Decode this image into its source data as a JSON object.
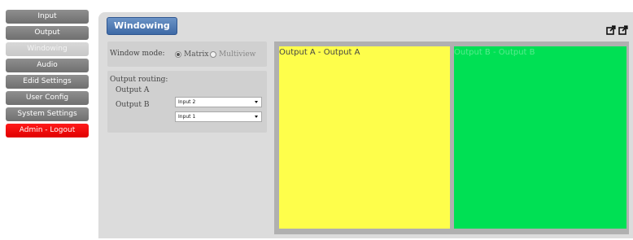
{
  "sidebar": {
    "items": [
      {
        "label": "Input"
      },
      {
        "label": "Output"
      },
      {
        "label": "Windowing"
      },
      {
        "label": "Audio"
      },
      {
        "label": "Edid Settings"
      },
      {
        "label": "User Config"
      },
      {
        "label": "System Settings"
      },
      {
        "label": "Admin - Logout"
      }
    ],
    "active_index": 2,
    "logout_color": "#ff0000"
  },
  "page": {
    "title": "Windowing",
    "icons": [
      "popout-icon",
      "popout-icon"
    ]
  },
  "mode": {
    "label": "Window mode:",
    "options": [
      {
        "label": "Matrix",
        "selected": true
      },
      {
        "label": "Multiview",
        "selected": false
      }
    ]
  },
  "routing": {
    "label": "Output routing:",
    "rows": [
      {
        "label": "Output A",
        "value": "Input 2"
      },
      {
        "label": "Output B",
        "value": "Input 1"
      }
    ]
  },
  "preview": {
    "windows": [
      {
        "label": "Output A - Output A",
        "color": "#fefe4b"
      },
      {
        "label": "Output B - Output B",
        "color": "#00e054"
      }
    ]
  }
}
